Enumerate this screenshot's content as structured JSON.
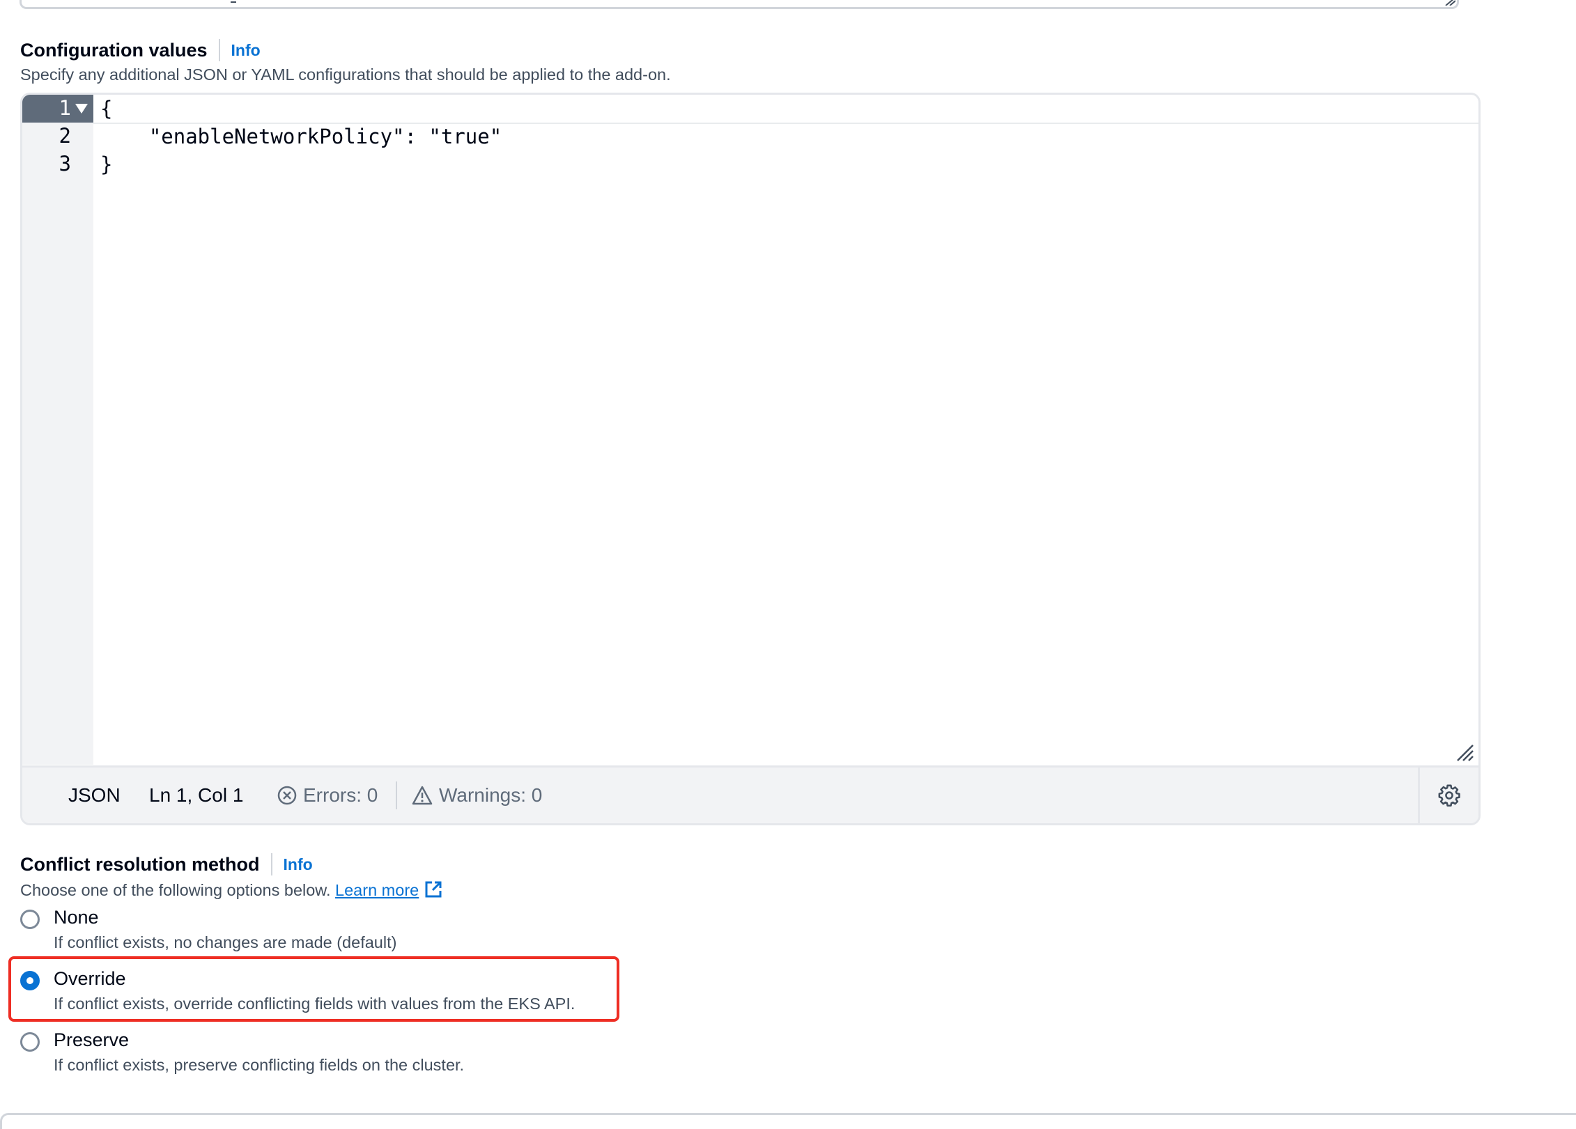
{
  "config": {
    "label": "Configuration values",
    "info": "Info",
    "description": "Specify any additional JSON or YAML configurations that should be applied to the add-on."
  },
  "editor": {
    "lines": [
      {
        "num": "1",
        "text": "{"
      },
      {
        "num": "2",
        "text": "    \"enableNetworkPolicy\": \"true\""
      },
      {
        "num": "3",
        "text": "}"
      }
    ],
    "status": {
      "language": "JSON",
      "cursor": "Ln 1, Col 1",
      "errors": "Errors: 0",
      "warnings": "Warnings: 0"
    },
    "icons": {
      "fold": "fold-caret-icon",
      "error": "error-circle-icon",
      "warning": "warning-triangle-icon",
      "settings": "gear-icon",
      "resize": "resize-handle-icon"
    }
  },
  "conflict": {
    "label": "Conflict resolution method",
    "info": "Info",
    "description": "Choose one of the following options below.",
    "learn_more": "Learn more",
    "selected": "Override",
    "options": [
      {
        "label": "None",
        "description": "If conflict exists, no changes are made (default)"
      },
      {
        "label": "Override",
        "description": "If conflict exists, override conflicting fields with values from the EKS API."
      },
      {
        "label": "Preserve",
        "description": "If conflict exists, preserve conflicting fields on the cluster."
      }
    ]
  },
  "colors": {
    "accent": "#0972d3",
    "highlight": "#ee2e24",
    "text": "#000716",
    "muted": "#414d5c"
  }
}
